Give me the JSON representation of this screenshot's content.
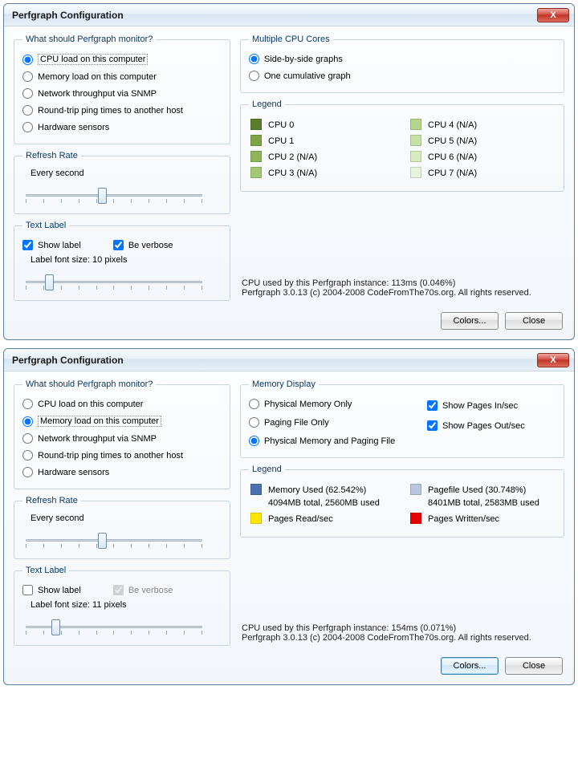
{
  "window_title": "Perfgraph Configuration",
  "close_x": "X",
  "monitor": {
    "legend": "What should Perfgraph monitor?",
    "cpu": "CPU load on this computer",
    "memory": "Memory load on this computer",
    "network": "Network throughput via SNMP",
    "ping": "Round-trip ping times to another host",
    "hw": "Hardware sensors"
  },
  "refresh": {
    "legend": "Refresh Rate",
    "label": "Every second"
  },
  "textlabel": {
    "legend": "Text Label",
    "show": "Show label",
    "verbose": "Be verbose",
    "fontsize_a": "Label font size: 10 pixels",
    "fontsize_b": "Label font size: 11 pixels"
  },
  "cpucores": {
    "legend": "Multiple CPU Cores",
    "sidebyside": "Side-by-side graphs",
    "cumulative": "One cumulative graph"
  },
  "cpulegend": {
    "legend": "Legend",
    "items_left": [
      "CPU 0",
      "CPU 1",
      "CPU 2 (N/A)",
      "CPU 3 (N/A)"
    ],
    "items_right": [
      "CPU 4 (N/A)",
      "CPU 5 (N/A)",
      "CPU 6 (N/A)",
      "CPU 7 (N/A)"
    ],
    "colors_left": [
      "#5a7d2b",
      "#7ea344",
      "#8fb656",
      "#a4c772"
    ],
    "colors_right": [
      "#b4d58a",
      "#c5e1a5",
      "#d5ebc0",
      "#e7f3dc"
    ]
  },
  "status_a1": "CPU used by this Perfgraph instance: 113ms (0.046%)",
  "status_a2": "Perfgraph 3.0.13 (c) 2004-2008 CodeFromThe70s.org. All rights reserved.",
  "memdisplay": {
    "legend": "Memory Display",
    "physonly": "Physical Memory Only",
    "pageonly": "Paging File Only",
    "both": "Physical Memory and Paging File",
    "pagesin": "Show Pages In/sec",
    "pagesout": "Show Pages Out/sec"
  },
  "memlegend": {
    "legend": "Legend",
    "mem_used_label": "Memory Used (62.542%)",
    "mem_used_sub": "4094MB total, 2560MB used",
    "pagefile_label": "Pagefile Used (30.748%)",
    "pagefile_sub": "8401MB total, 2583MB used",
    "pages_read": "Pages Read/sec",
    "pages_written": "Pages Written/sec",
    "c_mem": "#4a6fb3",
    "c_pf": "#b8c6df",
    "c_read": "#ffe600",
    "c_write": "#e60000"
  },
  "status_b1": "CPU used by this Perfgraph instance: 154ms (0.071%)",
  "status_b2": "Perfgraph 3.0.13 (c) 2004-2008 CodeFromThe70s.org. All rights reserved.",
  "buttons": {
    "colors": "Colors...",
    "close": "Close"
  }
}
